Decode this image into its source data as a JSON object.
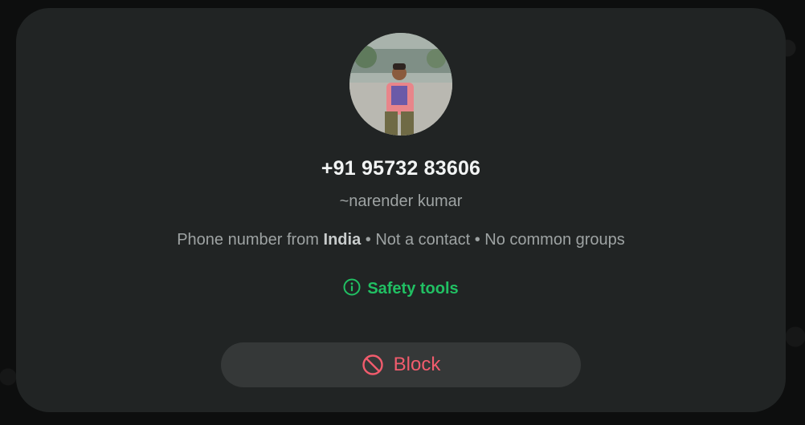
{
  "contact": {
    "phone": "+91 95732 83606",
    "username": "~narender kumar",
    "meta_prefix": "Phone number from ",
    "country": "India",
    "meta_suffix": " • Not a contact • No common groups"
  },
  "actions": {
    "safety_tools_label": "Safety tools",
    "block_label": "Block"
  },
  "colors": {
    "accent_green": "#21c063",
    "danger_red": "#f15c6d",
    "card_bg": "#212424"
  },
  "icons": {
    "safety": "info-circle-icon",
    "block": "block-circle-icon"
  }
}
